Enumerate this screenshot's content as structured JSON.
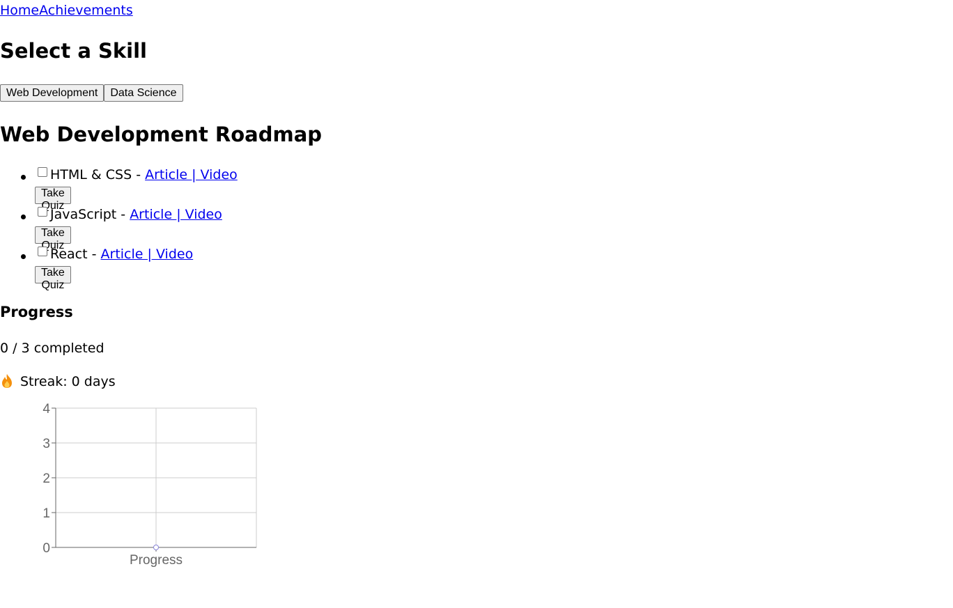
{
  "nav": {
    "home": "Home",
    "achievements": "Achievements"
  },
  "skills": {
    "heading": "Select a Skill",
    "buttons": [
      "Web Development",
      "Data Science"
    ]
  },
  "roadmap": {
    "heading": "Web Development Roadmap",
    "separator": " - ",
    "items": [
      {
        "name": "HTML & CSS",
        "article": " Article ",
        "divider": "|",
        "video": " Video",
        "quiz": "Take Quiz",
        "checked": false
      },
      {
        "name": "JavaScript",
        "article": " Article ",
        "divider": "|",
        "video": " Video",
        "quiz": "Take Quiz",
        "checked": false
      },
      {
        "name": "React",
        "article": " Article ",
        "divider": "|",
        "video": " Video",
        "quiz": "Take Quiz",
        "checked": false
      }
    ]
  },
  "progress": {
    "heading": "Progress",
    "completed_text": "0 / 3 completed",
    "streak_text": "Streak: 0 days",
    "streak_icon": "flame-icon"
  },
  "chart_data": {
    "type": "line",
    "categories": [
      "Progress"
    ],
    "series": [
      {
        "values": [
          0
        ]
      }
    ],
    "ylim": [
      0,
      4
    ],
    "yticks": [
      0,
      1,
      2,
      3,
      4
    ],
    "grid": true,
    "colors": {
      "point": "#8884d8",
      "grid": "#cccccc",
      "axis": "#666666"
    }
  }
}
